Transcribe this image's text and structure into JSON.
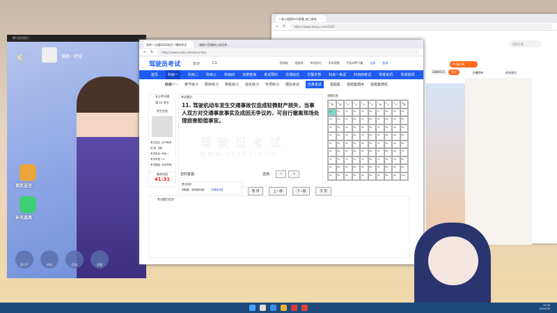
{
  "game": {
    "window_title": "腾讯游戏窗口",
    "player_name": "湖南一把没",
    "gift1": "首胜送豆",
    "gift2": "补充道具",
    "btns": [
      "换对手",
      "举报",
      "回放",
      "收藏"
    ]
  },
  "browser2": {
    "tab": "一条小团团OvO直播_热门游戏",
    "url": "https://www.douyu.com/2222",
    "search_placeholder": "搜索主播",
    "follow": "关注",
    "room_id": "2889415",
    "pc_client": "PC客户端",
    "rank1": "主播榜单",
    "rank2": "贵宾席位"
  },
  "browser1": {
    "tabs": [
      "驾考一点通2022科目一模拟考试",
      "湖南人民政府公务员考..."
    ],
    "url": "https://www.jsyks.com/kmy-fzks",
    "logo": "驾驶员考试",
    "city": "长沙",
    "car": "C1",
    "toplinks": [
      "找驾校",
      "找陪驾",
      "考试技巧",
      "学车视频",
      "手机APP下载"
    ],
    "register": "注册",
    "login": "登录",
    "nav": [
      "首页",
      "科目一",
      "科目二",
      "科目三",
      "科目四",
      "违章查询",
      "考试预约",
      "交通标志",
      "交警手势",
      "科目一考试",
      "科目四考试",
      "驾考资讯",
      "驾考新闻"
    ],
    "sub_title": "科目一",
    "sub": [
      "章节练习",
      "顺序练习",
      "随机练习",
      "强化练习",
      "专项练习",
      "模拟考试",
      "仿真考试",
      "错题集",
      "错题集顺序",
      "错题集随机"
    ],
    "exam_center": "长沙考试通",
    "seat": "第 10 考台",
    "examinee_info": "考生信息",
    "info": [
      "考生姓名: 元气驾考",
      "性 别: 未知",
      "考试科目: 科目一",
      "考试车型: C1",
      "考试原因: 初次申领"
    ],
    "remaining_label": "剩余时间",
    "remaining": "41:31",
    "question_header": "考试题目",
    "question": "11. 驾驶机动车发生交通事故仅造成轻微财产损失，当事人双方对交通事故事实及成因无争议的，可自行撤离现场处理损害赔偿事宜。",
    "watermark": "驾驶员考试",
    "watermark_url": "www.jsyks.com",
    "your_answer": "您的答案:",
    "choose": "选择:",
    "opt_true": "✓",
    "opt_false": "×",
    "answer_header": "答题信息",
    "first_row_marks": [
      "×",
      "×",
      "✓",
      "✓",
      "✓",
      "✓",
      "×",
      "✓",
      "✓",
      "×"
    ],
    "current": 11,
    "hint_title": "提示信息",
    "hint_text": "判断题，请判断对错！",
    "hint_link": "快捷键设置",
    "buttons": [
      "暂 停",
      "上一题",
      "下一题",
      "交 卷"
    ],
    "bottom_header": "考试题目信息"
  },
  "taskbar": {
    "time": "19:36",
    "date": "2022/7/8"
  }
}
